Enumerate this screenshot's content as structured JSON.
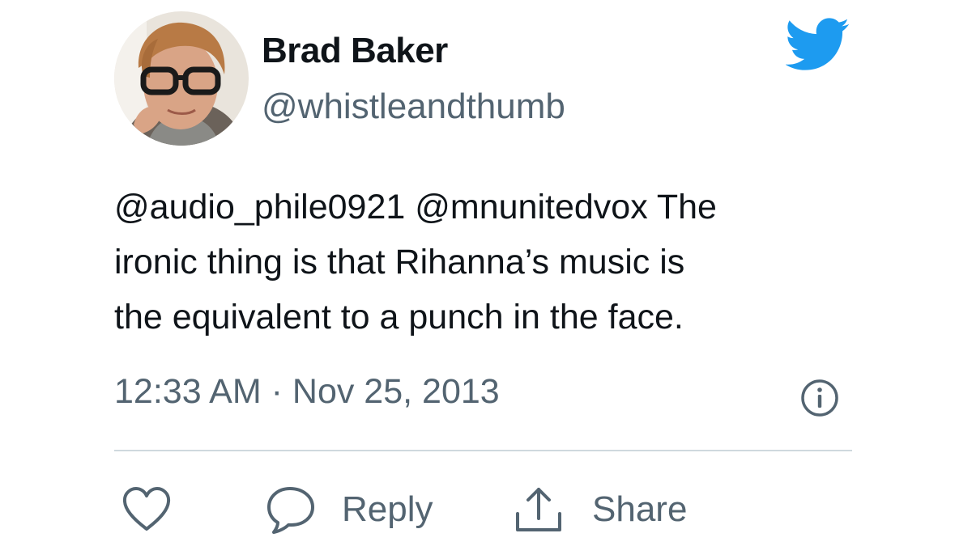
{
  "author": {
    "name": "Brad Baker",
    "handle": "@whistleandthumb"
  },
  "tweet": {
    "lines": [
      "@audio_phile0921 @mnunitedvox The",
      "ironic thing is that Rihanna’s music is",
      "the equivalent to a punch in the face."
    ],
    "timestamp": "12:33 AM · Nov 25, 2013"
  },
  "actions": {
    "reply_label": "Reply",
    "share_label": "Share"
  },
  "icons": {
    "brand": "twitter-bird-icon",
    "info": "info-icon",
    "like": "heart-icon",
    "reply": "speech-bubble-icon",
    "share": "share-upload-icon"
  },
  "colors": {
    "brand_blue": "#1d9bf0",
    "text_primary": "#0f1419",
    "text_secondary": "#536471",
    "divider": "#cfd9de"
  }
}
